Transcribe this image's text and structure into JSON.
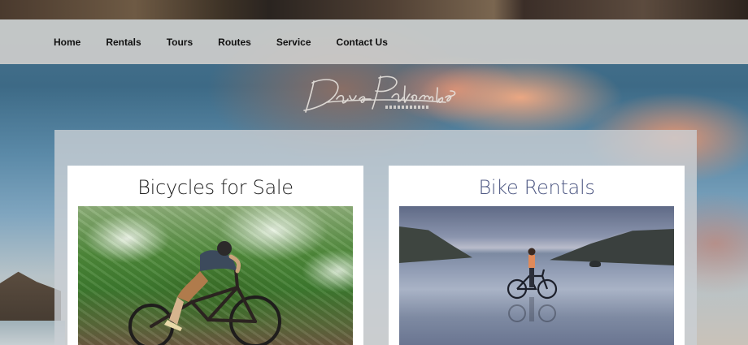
{
  "nav": {
    "items": [
      {
        "label": "Home"
      },
      {
        "label": "Rentals"
      },
      {
        "label": "Tours"
      },
      {
        "label": "Routes"
      },
      {
        "label": "Service"
      },
      {
        "label": "Contact Us"
      }
    ]
  },
  "logo": {
    "script": "Dave Palombo",
    "subtitle": "PHOTOGRAPHY"
  },
  "cards": [
    {
      "title": "Bicycles for Sale",
      "image_icon": "mountain-biker-photo"
    },
    {
      "title": "Bike Rentals",
      "image_icon": "beach-bike-photo"
    }
  ],
  "colors": {
    "nav_background": "#d4d1ce",
    "nav_text": "#111111",
    "card_title_sale": "#222222",
    "card_title_rentals": "#4d5782",
    "logo_color": "#e8e4df"
  }
}
